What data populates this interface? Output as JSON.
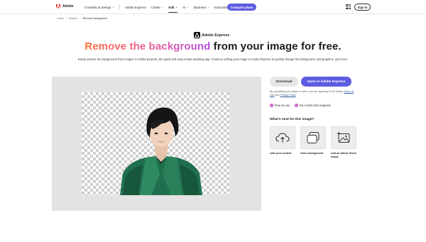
{
  "nav": {
    "brand": "Adobe",
    "items": [
      {
        "label": "Creativity & Design",
        "chevron": true,
        "active": false
      },
      {
        "label": "Adobe Express",
        "chevron": false,
        "active": false
      },
      {
        "label": "Create",
        "chevron": true,
        "active": false
      },
      {
        "label": "Edit",
        "chevron": true,
        "active": true
      },
      {
        "label": "AI",
        "chevron": true,
        "active": false
      },
      {
        "label": "Business",
        "chevron": true,
        "active": false
      },
      {
        "label": "Education",
        "chevron": true,
        "active": false
      }
    ],
    "compare_plans": "Compare plans",
    "sign_in": "Sign In",
    "accent_color": "#5c5ce0"
  },
  "breadcrumb": {
    "home": "Home",
    "feature": "Feature",
    "current": "Remove Background"
  },
  "hero": {
    "product_name": "Adobe Express",
    "headline_gradient": "Remove the background",
    "headline_rest": " from your image for free.",
    "subhead": "Easily remove the background from images in Adobe Express, the quick and easy create-anything app. Continue editing your image in Adobe Express to quickly change the background, add graphics, and more."
  },
  "actions": {
    "download": "Download",
    "open": "Open in Adobe Express"
  },
  "legal": {
    "prefix": "By uploading your image or video, you are agreeing to the Adobe",
    "terms": "Terms of Use",
    "and": " and ",
    "privacy": "Privacy Policy",
    "suffix": "."
  },
  "perks": [
    "Free to use",
    "No credit card required"
  ],
  "next": {
    "title": "What's next for this image?",
    "tiles": [
      {
        "label": "Add your content",
        "icon": "cloud-upload-icon"
      },
      {
        "label": "Add a background",
        "icon": "layers-icon"
      },
      {
        "label": "Add an Adobe Stock image",
        "icon": "image-sparkle-icon"
      }
    ]
  }
}
